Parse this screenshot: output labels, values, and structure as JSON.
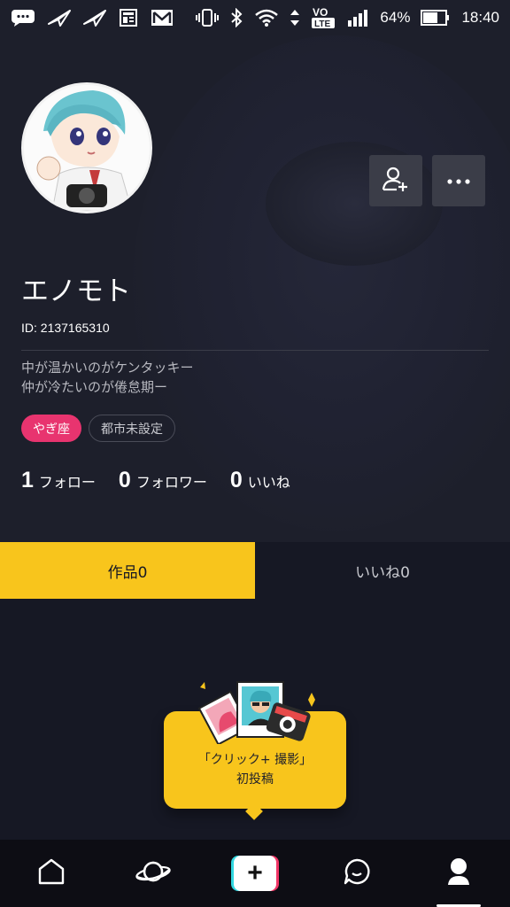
{
  "statusbar": {
    "battery": "64%",
    "time": "18:40",
    "network_label": "VO LTE",
    "icons": [
      "message-icon",
      "paper-plane-icon",
      "paper-plane-icon",
      "news-icon",
      "mail-icon",
      "vibrate-icon",
      "bluetooth-icon",
      "wifi-icon",
      "data-arrows-icon",
      "volte-icon",
      "signal-icon",
      "battery-icon"
    ]
  },
  "profile": {
    "name": "エノモト",
    "id": "ID: 2137165310",
    "bio_line1": "中が温かいのがケンタッキー",
    "bio_line2": "仲が冷たいのが倦怠期ー",
    "tag_zodiac": "やぎ座",
    "tag_city": "都市未設定"
  },
  "stats": {
    "follow_count": "1",
    "follow_label": "フォロー",
    "follower_count": "0",
    "follower_label": "フォロワー",
    "likes_count": "0",
    "likes_label": "いいね"
  },
  "tabs": {
    "works": "作品0",
    "likes": "いいね0"
  },
  "empty": {
    "line1": "「クリック+ 撮影」",
    "line2": "初投稿"
  },
  "colors": {
    "accent": "#f8c51c",
    "tag_pink": "#e8346f",
    "background": "#161824"
  },
  "nav": {
    "items": [
      "home-icon",
      "planet-icon",
      "create-icon",
      "message-icon",
      "profile-icon"
    ],
    "active": "profile-icon"
  }
}
